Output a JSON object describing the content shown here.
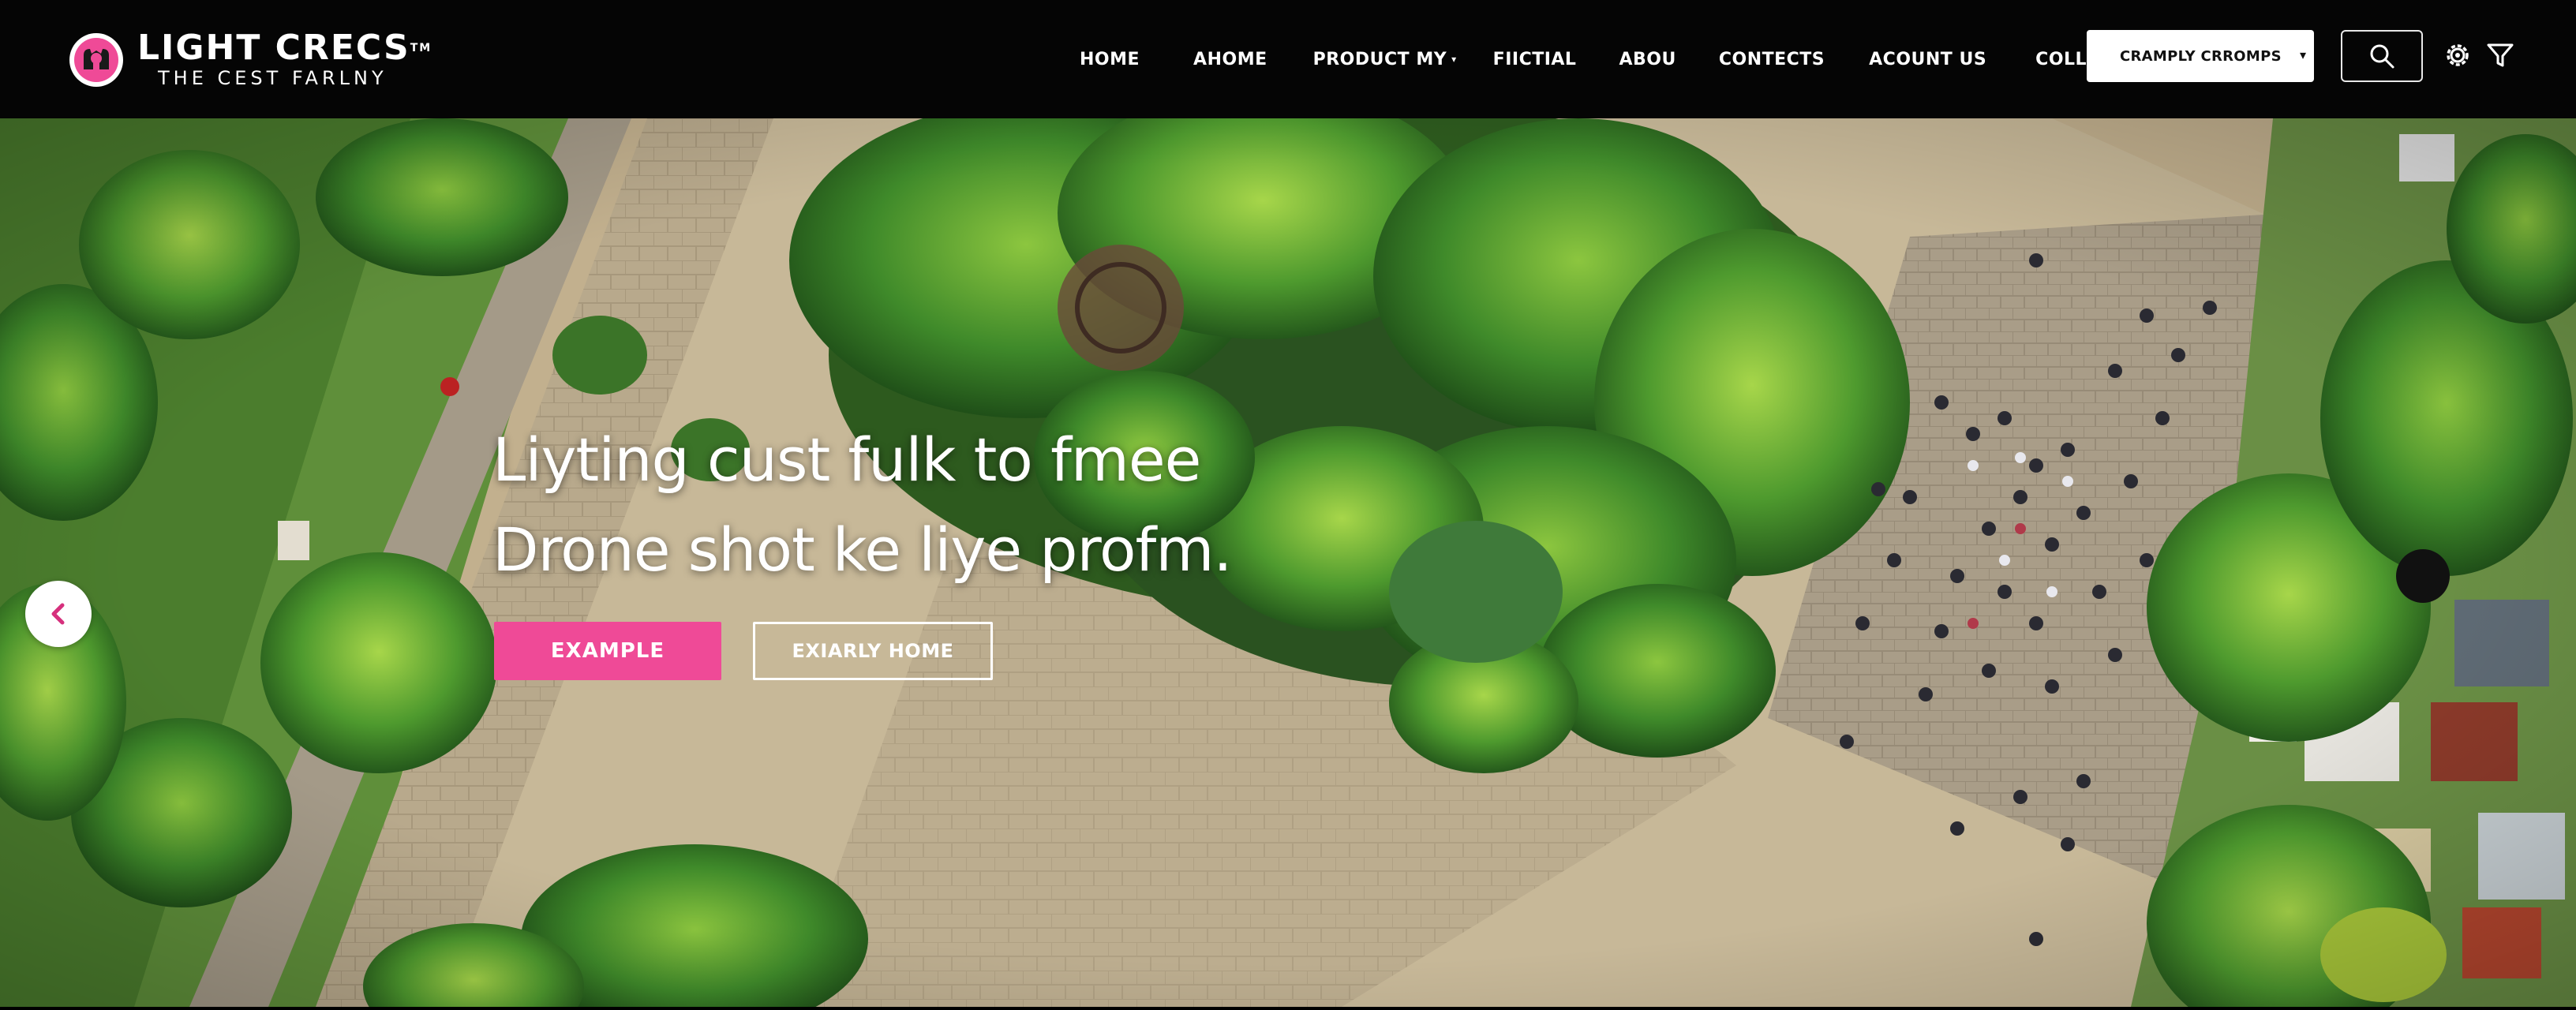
{
  "brand": {
    "title": "LIGHT CRECS",
    "trademark": "TM",
    "subtitle": "THE CEST FARLNY",
    "accent_color": "#ef4a97"
  },
  "nav": {
    "items": [
      {
        "label": "HOME"
      },
      {
        "label": "AHOME"
      },
      {
        "label": "PRODUCT MY",
        "has_dropdown": true
      },
      {
        "label": "FIICTIAL"
      },
      {
        "label": "ABOU"
      },
      {
        "label": "CONTECTS"
      },
      {
        "label": "ACOUNT US"
      },
      {
        "label": "COLLACES"
      }
    ]
  },
  "header_select": {
    "value": "CRAMPLY CRROMPS",
    "icon": "chevron-down-icon"
  },
  "header_icons": [
    "search-icon",
    "settings-icon",
    "filter-icon"
  ],
  "hero": {
    "headline_line1": "Liyting cust fulk to fmee",
    "headline_line2": "Drone shot ke liye profm.",
    "primary_button": "EXAMPLE",
    "secondary_button": "EXIARLY HOME",
    "prev_icon": "chevron-left-icon"
  }
}
